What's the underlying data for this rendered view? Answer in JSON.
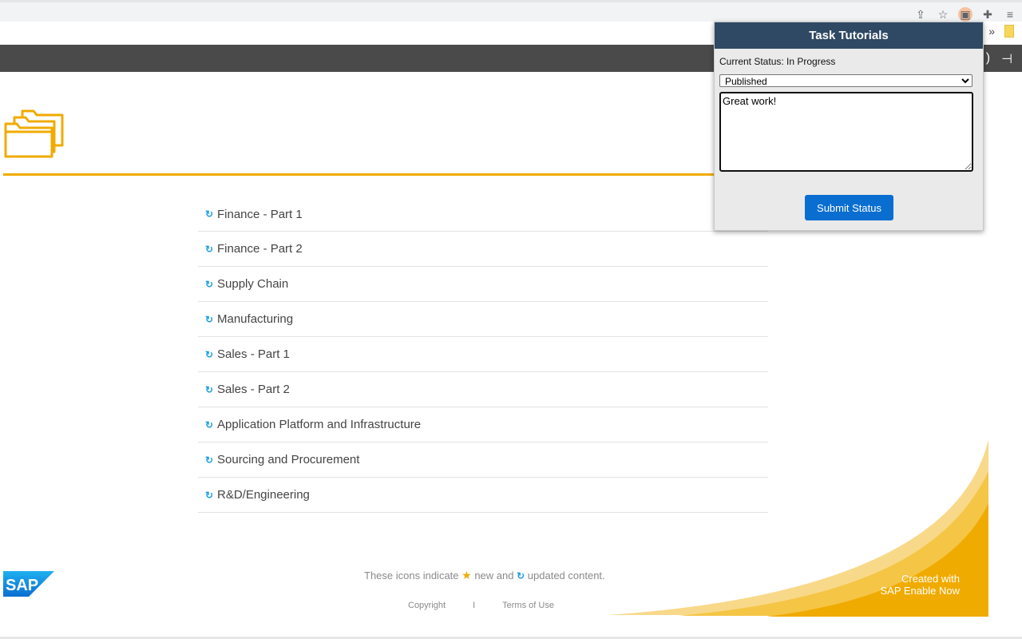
{
  "browser": {
    "icons": [
      "share-icon",
      "star-icon",
      "extension-active-icon",
      "puzzle-icon",
      "reading-list-icon"
    ],
    "bookmarks_overflow": "»"
  },
  "content": {
    "items": [
      {
        "label": "Finance - Part 1"
      },
      {
        "label": "Finance - Part 2"
      },
      {
        "label": "Supply Chain"
      },
      {
        "label": "Manufacturing"
      },
      {
        "label": "Sales - Part 1"
      },
      {
        "label": "Sales - Part 2"
      },
      {
        "label": "Application Platform and Infrastructure"
      },
      {
        "label": "Sourcing and Procurement"
      },
      {
        "label": "R&D/Engineering"
      }
    ]
  },
  "footer": {
    "legend_prefix": "These icons indicate",
    "legend_middle": "new and",
    "legend_suffix": "updated content.",
    "copyright": "Copyright",
    "separator": "I",
    "terms": "Terms of Use",
    "created_line1": "Created with",
    "created_line2": "SAP Enable Now",
    "logo_text": "SAP"
  },
  "popup": {
    "title": "Task Tutorials",
    "current_status": "Current Status: In Progress",
    "selected_option": "Published",
    "comment": "Great work!",
    "submit_label": "Submit Status"
  },
  "colors": {
    "accent_orange": "#f0ab00",
    "popup_header": "#2f4964",
    "button_blue": "#0a6ed1",
    "refresh_blue": "#1f9ee0"
  }
}
